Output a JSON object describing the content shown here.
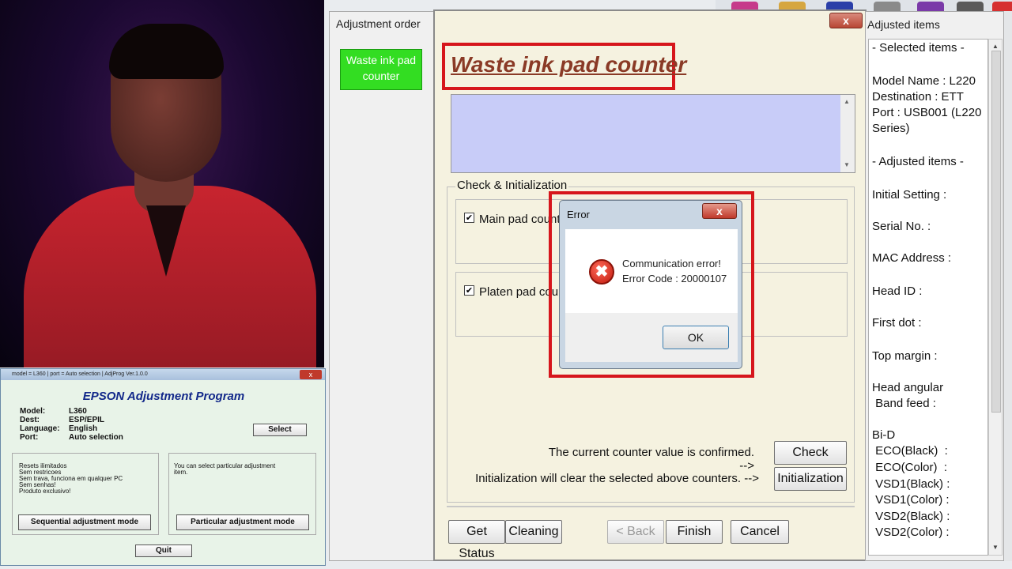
{
  "adjustment_order": {
    "title": "Adjustment order",
    "item_line1": "Waste ink pad",
    "item_line2": "counter"
  },
  "main": {
    "close_glyph": "x",
    "title": "Waste ink pad counter",
    "group_label": "Check & Initialization",
    "main_pad_label": "Main pad counte",
    "platen_pad_label": "Platen pad count",
    "check_mark": "✔",
    "confirm_text": "The current counter value is confirmed. -->",
    "init_text": "Initialization will clear the selected above counters. -->",
    "check_button": "Check",
    "init_button": "Initialization",
    "get_status_button": "Get Status",
    "cleaning_button": "Cleaning",
    "back_button": "< Back",
    "finish_button": "Finish",
    "cancel_button": "Cancel"
  },
  "error_dialog": {
    "title": "Error",
    "close_glyph": "x",
    "icon_glyph": "✖",
    "message_line1": "Communication error!",
    "message_line2": "Error Code : 20000107",
    "ok_button": "OK"
  },
  "adjusted_items": {
    "title": "Adjusted items",
    "lines": [
      "- Selected items -",
      "Model Name : L220",
      "Destination : ETT",
      "Port : USB001 (L220",
      "Series)",
      "- Adjusted items -",
      "Initial Setting :",
      "Serial No. :",
      "MAC Address :",
      "Head ID :",
      "First dot :",
      "Top margin :",
      "Head angular",
      " Band feed :",
      "Bi-D",
      " ECO(Black)  :",
      " ECO(Color)  :",
      " VSD1(Black) :",
      " VSD1(Color) :",
      " VSD2(Black) :",
      " VSD2(Color) :"
    ]
  },
  "epson_window": {
    "titlebar": "model = L360 | port = Auto selection | AdjProg Ver.1.0.0",
    "close_glyph": "x",
    "title": "EPSON Adjustment Program",
    "fields": [
      {
        "k": "Model:",
        "v": "L360"
      },
      {
        "k": "Dest:",
        "v": "ESP/EPIL"
      },
      {
        "k": "Language:",
        "v": "English"
      },
      {
        "k": "Port:",
        "v": "Auto selection"
      }
    ],
    "select_button": "Select",
    "left_box_text": "Resets ilimitados\nSem restricoes\nSem trava, funciona em qualquer PC\nSem senhas!\nProduto exclusivo!",
    "right_box_text": "You can select particular adjustment\nitem.",
    "sequential_button": "Sequential adjustment mode",
    "particular_button": "Particular adjustment mode",
    "quit_button": "Quit"
  }
}
